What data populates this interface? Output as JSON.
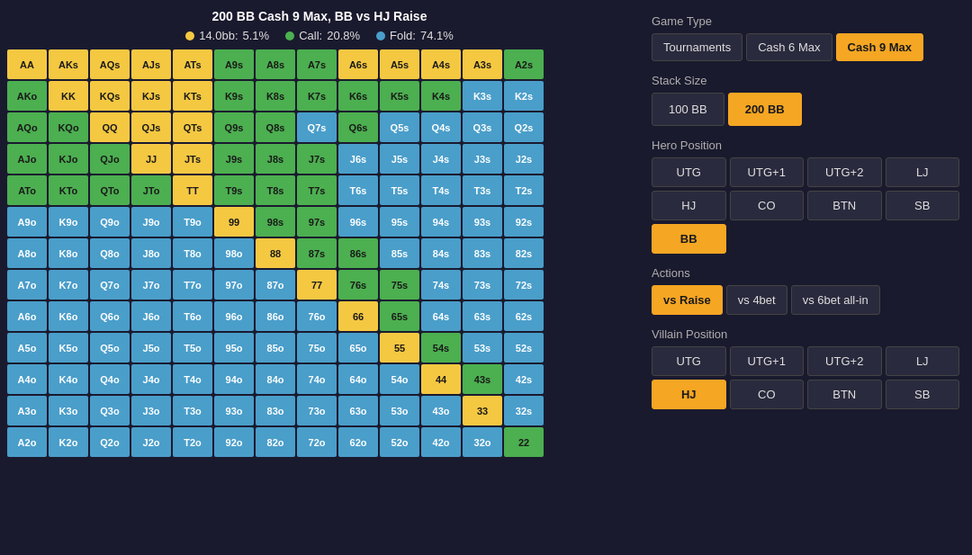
{
  "title": "200 BB Cash 9 Max, BB vs HJ Raise",
  "legend": {
    "raise": {
      "label": "14.0bb:",
      "value": "5.1%",
      "color": "#f5c842"
    },
    "call": {
      "label": "Call:",
      "value": "20.8%",
      "color": "#4caf50"
    },
    "fold": {
      "label": "Fold:",
      "value": "74.1%",
      "color": "#4a9eca"
    }
  },
  "gameType": {
    "label": "Game Type",
    "buttons": [
      "Tournaments",
      "Cash 6 Max",
      "Cash 9 Max"
    ],
    "active": "Cash 9 Max"
  },
  "stackSize": {
    "label": "Stack Size",
    "buttons": [
      "100\nBB",
      "200\nBB"
    ],
    "active": "200\nBB"
  },
  "heroPosition": {
    "label": "Hero Position",
    "buttons": [
      "UTG",
      "UTG+1",
      "UTG+2",
      "LJ",
      "HJ",
      "CO",
      "BTN",
      "SB",
      "BB"
    ],
    "active": "BB"
  },
  "actions": {
    "label": "Actions",
    "buttons": [
      "vs Raise",
      "vs 4bet",
      "vs 6bet\nall-in"
    ],
    "active": "vs Raise"
  },
  "villainPosition": {
    "label": "Villain Position",
    "buttons": [
      "UTG",
      "UTG+1",
      "UTG+2",
      "LJ",
      "HJ",
      "CO",
      "BTN",
      "SB"
    ],
    "active": "HJ"
  },
  "grid": [
    [
      "AA:y",
      "AKs:y",
      "AQs:y",
      "AJs:y",
      "ATs:y",
      "A9s:g",
      "A8s:g",
      "A7s:g",
      "A6s:y",
      "A5s:y",
      "A4s:y",
      "A3s:y",
      "A2s:g"
    ],
    [
      "AKo:g",
      "KK:y",
      "KQs:y",
      "KJs:y",
      "KTs:y",
      "K9s:g",
      "K8s:g",
      "K7s:g",
      "K6s:g",
      "K5s:g",
      "K4s:g",
      "K3s:b",
      "K2s:b"
    ],
    [
      "AQo:g",
      "KQo:g",
      "QQ:y",
      "QJs:y",
      "QTs:y",
      "Q9s:g",
      "Q8s:g",
      "Q7s:b",
      "Q6s:g",
      "Q5s:b",
      "Q4s:b",
      "Q3s:b",
      "Q2s:b"
    ],
    [
      "AJo:g",
      "KJo:g",
      "QJo:g",
      "JJ:y",
      "JTs:y",
      "J9s:g",
      "J8s:g",
      "J7s:g",
      "J6s:b",
      "J5s:b",
      "J4s:b",
      "J3s:b",
      "J2s:b"
    ],
    [
      "ATo:g",
      "KTo:g",
      "QTo:g",
      "JTo:g",
      "TT:y",
      "T9s:g",
      "T8s:g",
      "T7s:g",
      "T6s:b",
      "T5s:b",
      "T4s:b",
      "T3s:b",
      "T2s:b"
    ],
    [
      "A9o:b",
      "K9o:b",
      "Q9o:b",
      "J9o:b",
      "T9o:b",
      "99:y",
      "98s:g",
      "97s:g",
      "96s:b",
      "95s:b",
      "94s:b",
      "93s:b",
      "92s:b"
    ],
    [
      "A8o:b",
      "K8o:b",
      "Q8o:b",
      "J8o:b",
      "T8o:b",
      "98o:b",
      "88:y",
      "87s:g",
      "86s:g",
      "85s:b",
      "84s:b",
      "83s:b",
      "82s:b"
    ],
    [
      "A7o:b",
      "K7o:b",
      "Q7o:b",
      "J7o:b",
      "T7o:b",
      "97o:b",
      "87o:b",
      "77:y",
      "76s:g",
      "75s:g",
      "74s:b",
      "73s:b",
      "72s:b"
    ],
    [
      "A6o:b",
      "K6o:b",
      "Q6o:b",
      "J6o:b",
      "T6o:b",
      "96o:b",
      "86o:b",
      "76o:b",
      "66:y",
      "65s:g",
      "64s:b",
      "63s:b",
      "62s:b"
    ],
    [
      "A5o:b",
      "K5o:b",
      "Q5o:b",
      "J5o:b",
      "T5o:b",
      "95o:b",
      "85o:b",
      "75o:b",
      "65o:b",
      "55:y",
      "54s:g",
      "53s:b",
      "52s:b"
    ],
    [
      "A4o:b",
      "K4o:b",
      "Q4o:b",
      "J4o:b",
      "T4o:b",
      "94o:b",
      "84o:b",
      "74o:b",
      "64o:b",
      "54o:b",
      "44:y",
      "43s:g",
      "42s:b"
    ],
    [
      "A3o:b",
      "K3o:b",
      "Q3o:b",
      "J3o:b",
      "T3o:b",
      "93o:b",
      "83o:b",
      "73o:b",
      "63o:b",
      "53o:b",
      "43o:b",
      "33:y",
      "32s:b"
    ],
    [
      "A2o:b",
      "K2o:b",
      "Q2o:b",
      "J2o:b",
      "T2o:b",
      "92o:b",
      "82o:b",
      "72o:b",
      "62o:b",
      "52o:b",
      "42o:b",
      "32o:b",
      "22:g"
    ]
  ]
}
